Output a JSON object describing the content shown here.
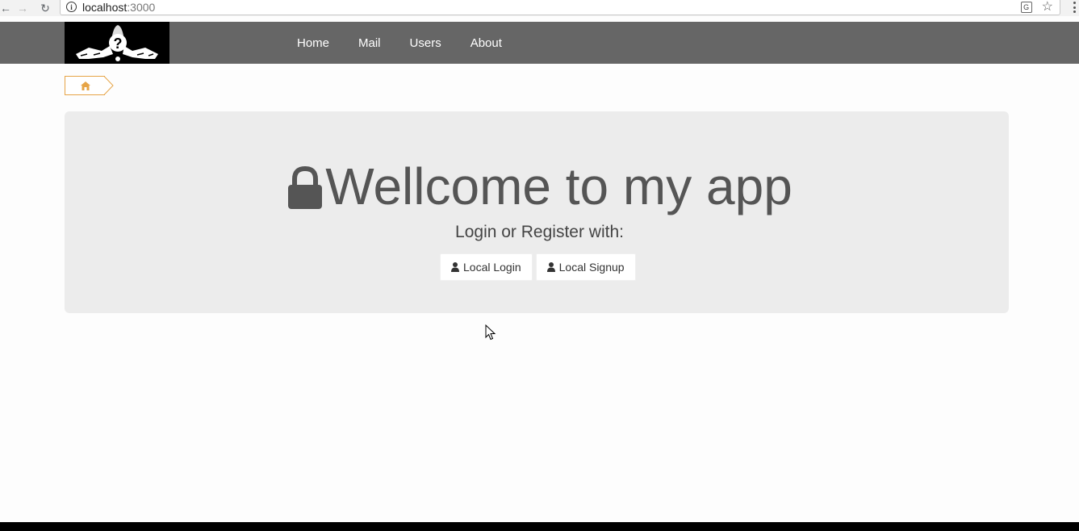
{
  "browser": {
    "url_host": "localhost",
    "url_port": ":3000",
    "info_glyph": "i",
    "translate_glyph": "G",
    "star_glyph": "☆",
    "back_glyph": "←",
    "forward_glyph": "→",
    "reload_glyph": "↻"
  },
  "navbar": {
    "items": [
      {
        "label": "Home"
      },
      {
        "label": "Mail"
      },
      {
        "label": "Users"
      },
      {
        "label": "About"
      }
    ]
  },
  "breadcrumb": {
    "icon": "home-icon"
  },
  "jumbotron": {
    "title": "Wellcome to my app",
    "subtitle": "Login or Register with:",
    "buttons": [
      {
        "label": "Local Login",
        "icon": "user-icon"
      },
      {
        "label": "Local Signup",
        "icon": "user-icon"
      }
    ]
  },
  "colors": {
    "navbar_bg": "#666666",
    "breadcrumb_accent": "#e6a446",
    "jumbotron_bg": "#ececec",
    "title_text": "#555555"
  }
}
